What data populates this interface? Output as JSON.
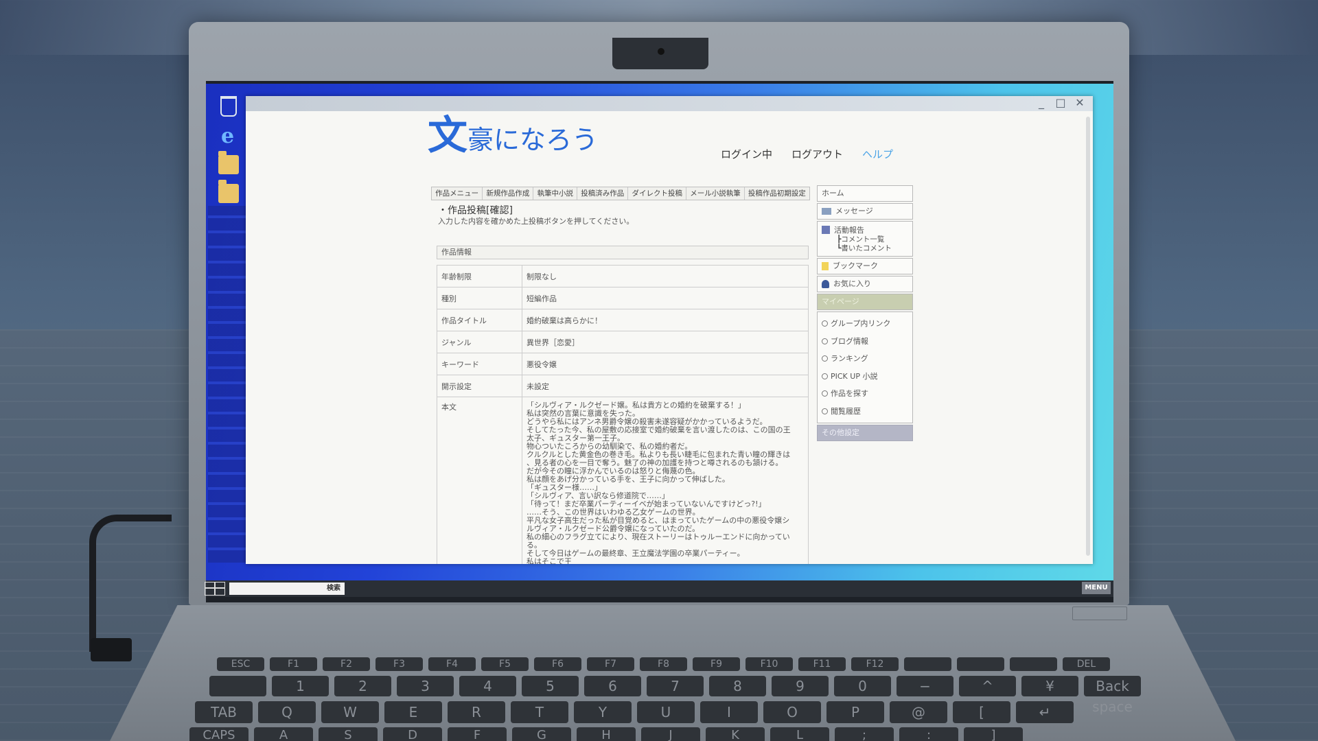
{
  "colors": {
    "brand_blue": "#2a6ad8",
    "help_link": "#4aa3e6",
    "green_bar": "#c8ceb0",
    "gray_bar": "#b4b6c6"
  },
  "desktop": {
    "icons": [
      "trash-icon",
      "ie-icon",
      "folder-icon",
      "folder-icon"
    ]
  },
  "window": {
    "controls": {
      "minimize": "_",
      "maximize": "□",
      "close": "✕"
    }
  },
  "site": {
    "logo_big": "文",
    "logo_rest": "豪になろう",
    "top_links": {
      "login_status": "ログイン中",
      "logout": "ログアウト",
      "help": "ヘルプ"
    },
    "tabs": [
      "作品メニュー",
      "新規作品作成",
      "執筆中小説",
      "投稿済み作品",
      "ダイレクト投稿",
      "メール小説執筆",
      "投稿作品初期設定"
    ]
  },
  "form": {
    "title": "・作品投稿[確認]",
    "description": "入力した内容を確かめた上投稿ボタンを押してください。",
    "section_header": "作品情報",
    "rows": [
      {
        "key": "年齢制限",
        "value": "制限なし"
      },
      {
        "key": "種別",
        "value": "短編作品"
      },
      {
        "key": "作品タイトル",
        "value": "婚約破棄は高らかに！"
      },
      {
        "key": "ジャンル",
        "value": "異世界［恋愛］"
      },
      {
        "key": "キーワード",
        "value": "悪役令嬢"
      },
      {
        "key": "開示設定",
        "value": "未設定"
      }
    ],
    "body_label": "本文",
    "body_text": "「シルヴィア・ルクゼード嬢。私は貴方との婚約を破棄する！」\n私は突然の言葉に意識を失った。\nどうやら私にはアンネ男爵令嬢の殺害未遂容疑がかかっているようだ。\nそしてたった今、私の屋敷の応接室で婚約破棄を言い渡したのは、この国の王\n太子、ギュスター第一王子。\n物心ついたころからの幼馴染で、私の婚約者だ。\nクルクルとした黄金色の巻き毛。私よりも長い睫毛に包まれた青い瞳の輝きは\n、見る者の心を一目で奪う。魅了の神の加護を持つと噂されるのも頷ける。\nだが今その瞳に浮かんでいるのは怒りと侮蔑の色。\n私は顔をあげ分かっている手を、王子に向かって伸ばした。\n「ギュスター様……」\n「シルヴィア、言い訳なら修道院で……」\n「待って！まだ卒業パーティーイベが始まっていないんですけどっ?!」\n……そう、この世界はいわゆる乙女ゲームの世界。\n平凡な女子高生だった私が目覚めると、はまっていたゲームの中の悪役令嬢シ\nルヴィア・ルクゼード公爵令嬢になっていたのだ。\n私の細心のフラグ立てにより、現在ストーリーはトゥルーエンドに向かってい\nる。\nそして今日はゲームの最終章、王立魔法学園の卒業パーティー。\n私はそこで王\nユスター王子に婚約を破棄される流れだ。"
  },
  "sidemenu": {
    "home": "ホーム",
    "message": "メッセージ",
    "activity": "活動報告",
    "activity_sub": [
      "┣コメント一覧",
      "┗書いたコメント"
    ],
    "bookmark": "ブックマーク",
    "favorites": "お気に入り",
    "mypage": "マイページ",
    "links": [
      "グループ内リンク",
      "ブログ情報",
      "ランキング",
      "PICK UP 小説",
      "作品を探す",
      "閲覧履歴"
    ],
    "other_settings": "その他設定"
  },
  "taskbar": {
    "search_label": "検索",
    "menu_label": "MENU"
  },
  "keyboard": {
    "function_row": [
      "ESC",
      "F1",
      "F2",
      "F3",
      "F4",
      "F5",
      "F6",
      "F7",
      "F8",
      "F9",
      "F10",
      "F11",
      "F12",
      "",
      "",
      "",
      "DEL"
    ],
    "number_row": [
      "",
      "1",
      "2",
      "3",
      "4",
      "5",
      "6",
      "7",
      "8",
      "9",
      "0",
      "−",
      "^",
      "¥",
      "Back space"
    ],
    "qwerty_row": [
      "TAB",
      "Q",
      "W",
      "E",
      "R",
      "T",
      "Y",
      "U",
      "I",
      "O",
      "P",
      "@",
      "[",
      "↵"
    ],
    "asdf_row": [
      "CAPS",
      "A",
      "S",
      "D",
      "F",
      "G",
      "H",
      "J",
      "K",
      "L",
      ";",
      ":",
      "]"
    ]
  }
}
